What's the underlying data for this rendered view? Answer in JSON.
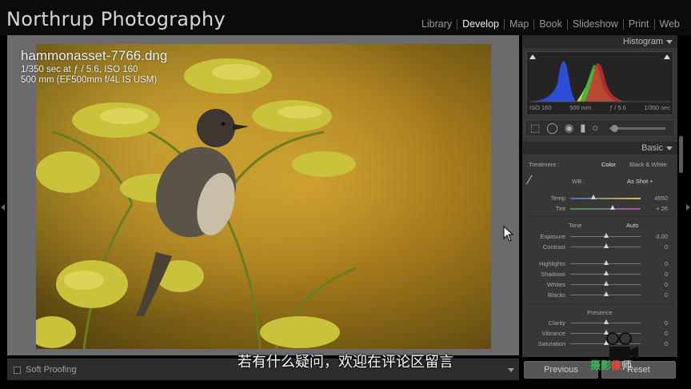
{
  "identity_plate": "Northrup Photography",
  "modules": [
    {
      "label": "Library",
      "active": false
    },
    {
      "label": "Develop",
      "active": true
    },
    {
      "label": "Map",
      "active": false
    },
    {
      "label": "Book",
      "active": false
    },
    {
      "label": "Slideshow",
      "active": false
    },
    {
      "label": "Print",
      "active": false
    },
    {
      "label": "Web",
      "active": false
    }
  ],
  "photo_info": {
    "filename": "hammonasset-7766.dng",
    "exposure": "1/350 sec at ƒ / 5.6, ISO 160",
    "lens": "500 mm (EF500mm f/4L IS USM)"
  },
  "toolbar": {
    "soft_proofing_label": "Soft Proofing"
  },
  "histogram": {
    "title": "Histogram",
    "iso": "ISO 160",
    "focal": "500 mm",
    "aperture": "ƒ / 5.6",
    "shutter": "1/350 sec"
  },
  "basic": {
    "title": "Basic",
    "treatment_label": "Treatment :",
    "treatment_color": "Color",
    "treatment_bw": "Black & White",
    "wb_label": "WB :",
    "wb_value": "As Shot ÷",
    "temp_label": "Temp",
    "temp_value": "4950",
    "tint_label": "Tint",
    "tint_value": "+ 26",
    "tone_label": "Tone",
    "auto_label": "Auto",
    "exposure_label": "Exposure",
    "exposure_value": "0.00",
    "contrast_label": "Contrast",
    "contrast_value": "0",
    "highlights_label": "Highlights",
    "highlights_value": "0",
    "shadows_label": "Shadows",
    "shadows_value": "0",
    "whites_label": "Whites",
    "whites_value": "0",
    "blacks_label": "Blacks",
    "blacks_value": "0",
    "presence_label": "Presence",
    "clarity_label": "Clarity",
    "clarity_value": "0",
    "vibrance_label": "Vibrance",
    "vibrance_value": "0",
    "saturation_label": "Saturation",
    "saturation_value": "0"
  },
  "buttons": {
    "previous": "Previous",
    "reset": "Reset"
  },
  "caption": "若有什么疑问，欢迎在评论区留言",
  "watermark": {
    "text_a": "摄影",
    "text_b": "像",
    "text_c": "师"
  },
  "colors": {
    "active_module": "#f0f0f0",
    "inactive_module": "#9a9a9a",
    "panel_bg": "#373737"
  }
}
